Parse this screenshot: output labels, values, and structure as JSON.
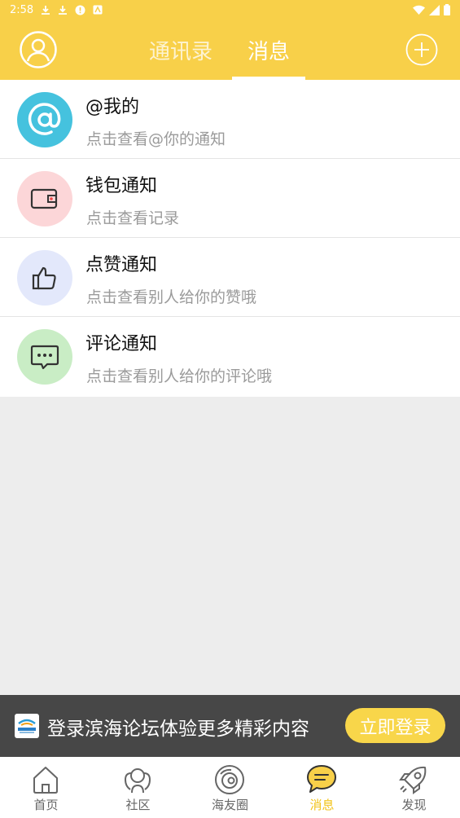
{
  "status_bar": {
    "time": "2:58"
  },
  "header": {
    "tabs": [
      {
        "label": "通讯录",
        "active": false
      },
      {
        "label": "消息",
        "active": true
      }
    ]
  },
  "messages": [
    {
      "title": "@我的",
      "subtitle": "点击查看@你的通知",
      "icon": "at-icon",
      "icon_bg": "#45c2de"
    },
    {
      "title": "钱包通知",
      "subtitle": "点击查看记录",
      "icon": "wallet-icon",
      "icon_bg": "#fcd6d8"
    },
    {
      "title": "点赞通知",
      "subtitle": "点击查看别人给你的赞哦",
      "icon": "thumbs-up-icon",
      "icon_bg": "#e3e8fb"
    },
    {
      "title": "评论通知",
      "subtitle": "点击查看别人给你的评论哦",
      "icon": "comment-icon",
      "icon_bg": "#c9edc5"
    }
  ],
  "login_banner": {
    "text": "登录滨海论坛体验更多精彩内容",
    "button": "立即登录"
  },
  "bottom_nav": [
    {
      "label": "首页",
      "icon": "home-icon",
      "active": false
    },
    {
      "label": "社区",
      "icon": "community-icon",
      "active": false
    },
    {
      "label": "海友圈",
      "icon": "circle-icon",
      "active": false
    },
    {
      "label": "消息",
      "icon": "message-icon",
      "active": true
    },
    {
      "label": "发现",
      "icon": "rocket-icon",
      "active": false
    }
  ],
  "colors": {
    "primary": "#f8d049",
    "active_tab_text": "#f2c318",
    "banner_bg": "#474747",
    "page_bg": "#ededed"
  }
}
